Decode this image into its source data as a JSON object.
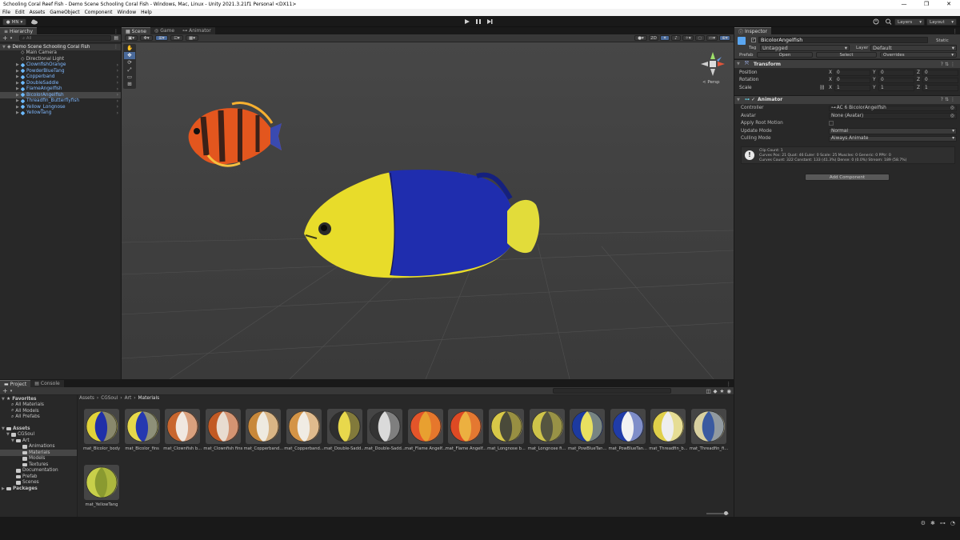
{
  "window": {
    "title": "Schooling Coral Reef Fish - Demo Scene Schooling Coral Fish - Windows, Mac, Linux - Unity 2021.3.21f1 Personal <DX11>",
    "controls": [
      "—",
      "❐",
      "✕"
    ]
  },
  "menu": [
    "File",
    "Edit",
    "Assets",
    "GameObject",
    "Component",
    "Window",
    "Help"
  ],
  "toolbar": {
    "account": "MN",
    "layers_label": "Layers",
    "layout_label": "Layout"
  },
  "hierarchy": {
    "tab": "Hierarchy",
    "search_placeholder": "All",
    "scene": "Demo Scene Schooling Coral Fish",
    "items": [
      {
        "label": "Main Camera",
        "prefab": false
      },
      {
        "label": "Directional Light",
        "prefab": false
      },
      {
        "label": "ClownfishOrange",
        "prefab": true
      },
      {
        "label": "PowderBlueTang",
        "prefab": true
      },
      {
        "label": "Copperband",
        "prefab": true
      },
      {
        "label": "DoubleSaddle",
        "prefab": true
      },
      {
        "label": "FlameAngelfish",
        "prefab": true
      },
      {
        "label": "BicolorAngelfish",
        "prefab": true
      },
      {
        "label": "Threadfin_Butterflyfish",
        "prefab": true
      },
      {
        "label": "Yellow_Longnose",
        "prefab": true
      },
      {
        "label": "YellowTang",
        "prefab": true
      }
    ]
  },
  "scene_view": {
    "tabs": [
      "Scene",
      "Game",
      "Animator"
    ],
    "mode_2d": "2D",
    "persp_label": "< Persp"
  },
  "inspector": {
    "tab": "Inspector",
    "object_name": "BicolorAngelfish",
    "static_label": "Static",
    "tag_label": "Tag",
    "tag_value": "Untagged",
    "layer_label": "Layer",
    "layer_value": "Default",
    "prefab_label": "Prefab",
    "prefab_open": "Open",
    "prefab_select": "Select",
    "prefab_overrides": "Overrides",
    "transform": {
      "title": "Transform",
      "rows": [
        {
          "label": "Position",
          "x": "0",
          "y": "0",
          "z": "0"
        },
        {
          "label": "Rotation",
          "x": "0",
          "y": "0",
          "z": "0"
        },
        {
          "label": "Scale",
          "x": "1",
          "y": "1",
          "z": "1"
        }
      ]
    },
    "animator": {
      "title": "Animator",
      "rows": [
        {
          "label": "Controller",
          "value": "AC 6 BicolorAngelfish"
        },
        {
          "label": "Avatar",
          "value": "None (Avatar)"
        },
        {
          "label": "Apply Root Motion",
          "value": ""
        },
        {
          "label": "Update Mode",
          "value": "Normal"
        },
        {
          "label": "Culling Mode",
          "value": "Always Animate"
        }
      ],
      "info_lines": [
        "Clip Count: 1",
        "Curves Pos: 21 Quat: 46 Euler: 0 Scale: 25 Muscles: 0 Generic: 0 PPtr: 0",
        "Curves Count: 322 Constant: 133 (41.3%) Dense: 0 (0.0%) Stream: 189 (58.7%)"
      ]
    },
    "add_component": "Add Component"
  },
  "project": {
    "tabs": [
      "Project",
      "Console"
    ],
    "favorites": "Favorites",
    "favorite_items": [
      "All Materials",
      "All Models",
      "All Prefabs"
    ],
    "assets": "Assets",
    "tree": [
      "CGSoul",
      "Art",
      "Animations",
      "Materials",
      "Models",
      "Textures",
      "Documentation",
      "Prefab",
      "Scenes"
    ],
    "packages": "Packages",
    "breadcrumb": [
      "Assets",
      "CGSoul",
      "Art",
      "Materials"
    ],
    "materials": [
      {
        "label": "mat_Bicolor_body",
        "a": "#e0d23a",
        "b": "#1f2fa8"
      },
      {
        "label": "mat_Bicolor_fins",
        "a": "#e6d84a",
        "b": "#2538b0"
      },
      {
        "label": "mat_Clownfish b...",
        "a": "#c8662e",
        "b": "#f0e8e0"
      },
      {
        "label": "mat_Clownfish fins",
        "a": "#c25a24",
        "b": "#e8dcd0"
      },
      {
        "label": "mat_Copperband...",
        "a": "#c8883a",
        "b": "#eeeae0"
      },
      {
        "label": "mat_Copperband...",
        "a": "#d49446",
        "b": "#f0ece4"
      },
      {
        "label": "mat_Double-Sadd...",
        "a": "#2e2e2e",
        "b": "#e8d84c"
      },
      {
        "label": "mat_Double-Sadd...",
        "a": "#343434",
        "b": "#dadada"
      },
      {
        "label": "mat_Flame Angelf...",
        "a": "#e4552a",
        "b": "#e8a030"
      },
      {
        "label": "mat_Flame Angelf...",
        "a": "#de4a24",
        "b": "#ecb040"
      },
      {
        "label": "mat_Longnose b...",
        "a": "#d8c848",
        "b": "#4a4a3a"
      },
      {
        "label": "mat_Longnose fi...",
        "a": "#cfc44a",
        "b": "#555540"
      },
      {
        "label": "mat_PowBlueTan...",
        "a": "#1c3aa0",
        "b": "#e8e060"
      },
      {
        "label": "mat_PowBlueTan...",
        "a": "#203ca8",
        "b": "#f2f2f2"
      },
      {
        "label": "mat_Threadfin_b...",
        "a": "#e0d04a",
        "b": "#eeeeee"
      },
      {
        "label": "mat_Threadfin_fi...",
        "a": "#d8d0a0",
        "b": "#3a5aa0"
      },
      {
        "label": "mat_YellowTang",
        "a": "#c8d04a",
        "b": "#8a9a30"
      }
    ]
  }
}
